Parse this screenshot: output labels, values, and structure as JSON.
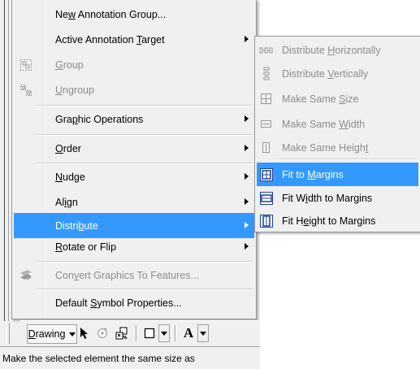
{
  "main_menu": {
    "items": [
      {
        "pre": "Ne",
        "u": "w",
        "post": " Annotation Group...",
        "disabled": false,
        "submenu": false
      },
      {
        "pre": "Active Annotation ",
        "u": "T",
        "post": "arget",
        "disabled": false,
        "submenu": true
      },
      {
        "pre": "",
        "u": "G",
        "post": "roup",
        "disabled": true,
        "submenu": false,
        "icon": "group-icon"
      },
      {
        "pre": "",
        "u": "U",
        "post": "ngroup",
        "disabled": true,
        "submenu": false,
        "icon": "ungroup-icon"
      },
      {
        "pre": "Gra",
        "u": "p",
        "post": "hic Operations",
        "disabled": false,
        "submenu": true
      },
      {
        "pre": "",
        "u": "O",
        "post": "rder",
        "disabled": false,
        "submenu": true
      },
      {
        "pre": "",
        "u": "N",
        "post": "udge",
        "disabled": false,
        "submenu": true
      },
      {
        "pre": "Al",
        "u": "i",
        "post": "gn",
        "disabled": false,
        "submenu": true
      },
      {
        "pre": "Distri",
        "u": "b",
        "post": "ute",
        "disabled": false,
        "submenu": true,
        "selected": true
      },
      {
        "pre": "",
        "u": "R",
        "post": "otate or Flip",
        "disabled": false,
        "submenu": true
      },
      {
        "pre": "Con",
        "u": "v",
        "post": "ert Graphics To Features...",
        "disabled": true,
        "submenu": false,
        "icon": "convert-graphics-icon"
      },
      {
        "pre": "Default ",
        "u": "S",
        "post": "ymbol Properties...",
        "disabled": false,
        "submenu": false
      }
    ]
  },
  "distribute_submenu": {
    "items": [
      {
        "pre": "Distribute ",
        "u": "H",
        "post": "orizontally",
        "disabled": true,
        "icon": "distribute-horizontally-icon"
      },
      {
        "pre": "Distribute ",
        "u": "V",
        "post": "ertically",
        "disabled": true,
        "icon": "distribute-vertically-icon"
      },
      {
        "pre": "Make Same ",
        "u": "S",
        "post": "ize",
        "disabled": true,
        "icon": "make-same-size-icon"
      },
      {
        "pre": "Make Same ",
        "u": "W",
        "post": "idth",
        "disabled": true,
        "icon": "make-same-width-icon"
      },
      {
        "pre": "Make Same Heigh",
        "u": "t",
        "post": "",
        "disabled": true,
        "icon": "make-same-height-icon"
      },
      {
        "pre": "Fit to ",
        "u": "M",
        "post": "argins",
        "disabled": false,
        "selected": true,
        "icon": "fit-to-margins-icon"
      },
      {
        "pre": "Fit W",
        "u": "i",
        "post": "dth to Margins",
        "disabled": false,
        "icon": "fit-width-to-margins-icon"
      },
      {
        "pre": "Fit H",
        "u": "e",
        "post": "ight to Margins",
        "disabled": false,
        "icon": "fit-height-to-margins-icon"
      }
    ]
  },
  "toolbar": {
    "drawing_pre": "",
    "drawing_u": "D",
    "drawing_post": "rawing",
    "text_tool_glyph": "A"
  },
  "status_bar": {
    "text": "Make the selected element the same size as"
  },
  "colors": {
    "highlight": "#3399ff",
    "menu_bg": "#f0f0f0",
    "disabled_text": "#8d8d8d",
    "icon_blue": "#1c3f95"
  }
}
